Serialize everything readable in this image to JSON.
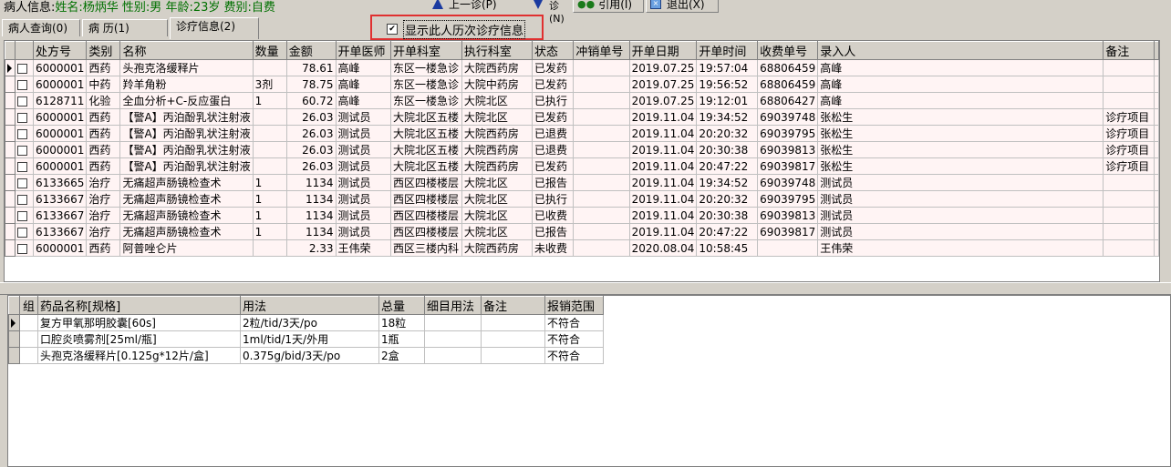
{
  "patient": {
    "label": "病人信息:",
    "name": "姓名:杨炳华",
    "gender": "性别:男",
    "age": "年龄:23岁",
    "fee_type": "费别:自费"
  },
  "toolbar": {
    "prev_label": "上一诊(P)",
    "next_label": "下一诊(N)",
    "cite_label": "引用(I)",
    "exit_label": "退出(X)"
  },
  "tabs": [
    {
      "label": "病人查询(0)"
    },
    {
      "label": "病 历(1)"
    },
    {
      "label": "诊疗信息(2)"
    }
  ],
  "show_history": {
    "label": "显示此人历次诊疗信息",
    "checked": "✔"
  },
  "orders": {
    "columns": [
      "处方号",
      "类别",
      "名称",
      "数量",
      "金额",
      "开单医师",
      "开单科室",
      "执行科室",
      "状态",
      "冲销单号",
      "开单日期",
      "开单时间",
      "收费单号",
      "录入人",
      "备注"
    ],
    "rows": [
      {
        "rx": "6000001",
        "cat": "西药",
        "name": "头孢克洛缓释片",
        "qty": "",
        "amt": "78.61",
        "doc": "高峰",
        "dept": "东区一楼急诊",
        "exec": "大院西药房",
        "status": "已发药",
        "cancel": "",
        "date": "2019.07.25",
        "time": "19:57:04",
        "fee": "68806459",
        "entry": "高峰",
        "note": ""
      },
      {
        "rx": "6000001",
        "cat": "中药",
        "name": "羚羊角粉",
        "qty": "3剂",
        "amt": "78.75",
        "doc": "高峰",
        "dept": "东区一楼急诊",
        "exec": "大院中药房",
        "status": "已发药",
        "cancel": "",
        "date": "2019.07.25",
        "time": "19:56:52",
        "fee": "68806459",
        "entry": "高峰",
        "note": ""
      },
      {
        "rx": "6128711",
        "cat": "化验",
        "name": "全血分析+C-反应蛋白",
        "qty": "1",
        "amt": "60.72",
        "doc": "高峰",
        "dept": "东区一楼急诊",
        "exec": "大院北区",
        "status": "已执行",
        "cancel": "",
        "date": "2019.07.25",
        "time": "19:12:01",
        "fee": "68806427",
        "entry": "高峰",
        "note": ""
      },
      {
        "rx": "6000001",
        "cat": "西药",
        "name": "【警A】丙泊酚乳状注射液",
        "qty": "",
        "amt": "26.03",
        "doc": "测试员",
        "dept": "大院北区五楼",
        "exec": "大院北区",
        "status": "已发药",
        "cancel": "",
        "date": "2019.11.04",
        "time": "19:34:52",
        "fee": "69039748",
        "entry": "张松生",
        "note": "诊疗项目"
      },
      {
        "rx": "6000001",
        "cat": "西药",
        "name": "【警A】丙泊酚乳状注射液",
        "qty": "",
        "amt": "26.03",
        "doc": "测试员",
        "dept": "大院北区五楼",
        "exec": "大院西药房",
        "status": "已退费",
        "cancel": "",
        "date": "2019.11.04",
        "time": "20:20:32",
        "fee": "69039795",
        "entry": "张松生",
        "note": "诊疗项目"
      },
      {
        "rx": "6000001",
        "cat": "西药",
        "name": "【警A】丙泊酚乳状注射液",
        "qty": "",
        "amt": "26.03",
        "doc": "测试员",
        "dept": "大院北区五楼",
        "exec": "大院西药房",
        "status": "已退费",
        "cancel": "",
        "date": "2019.11.04",
        "time": "20:30:38",
        "fee": "69039813",
        "entry": "张松生",
        "note": "诊疗项目"
      },
      {
        "rx": "6000001",
        "cat": "西药",
        "name": "【警A】丙泊酚乳状注射液",
        "qty": "",
        "amt": "26.03",
        "doc": "测试员",
        "dept": "大院北区五楼",
        "exec": "大院西药房",
        "status": "已发药",
        "cancel": "",
        "date": "2019.11.04",
        "time": "20:47:22",
        "fee": "69039817",
        "entry": "张松生",
        "note": "诊疗项目"
      },
      {
        "rx": "6133665",
        "cat": "治疗",
        "name": "无痛超声肠镜检查术",
        "qty": "1",
        "amt": "1134",
        "doc": "测试员",
        "dept": "西区四楼楼层",
        "exec": "大院北区",
        "status": "已报告",
        "cancel": "",
        "date": "2019.11.04",
        "time": "19:34:52",
        "fee": "69039748",
        "entry": "测试员",
        "note": ""
      },
      {
        "rx": "6133667",
        "cat": "治疗",
        "name": "无痛超声肠镜检查术",
        "qty": "1",
        "amt": "1134",
        "doc": "测试员",
        "dept": "西区四楼楼层",
        "exec": "大院北区",
        "status": "已执行",
        "cancel": "",
        "date": "2019.11.04",
        "time": "20:20:32",
        "fee": "69039795",
        "entry": "测试员",
        "note": ""
      },
      {
        "rx": "6133667",
        "cat": "治疗",
        "name": "无痛超声肠镜检查术",
        "qty": "1",
        "amt": "1134",
        "doc": "测试员",
        "dept": "西区四楼楼层",
        "exec": "大院北区",
        "status": "已收费",
        "cancel": "",
        "date": "2019.11.04",
        "time": "20:30:38",
        "fee": "69039813",
        "entry": "测试员",
        "note": ""
      },
      {
        "rx": "6133667",
        "cat": "治疗",
        "name": "无痛超声肠镜检查术",
        "qty": "1",
        "amt": "1134",
        "doc": "测试员",
        "dept": "西区四楼楼层",
        "exec": "大院北区",
        "status": "已报告",
        "cancel": "",
        "date": "2019.11.04",
        "time": "20:47:22",
        "fee": "69039817",
        "entry": "测试员",
        "note": ""
      },
      {
        "rx": "6000001",
        "cat": "西药",
        "name": "阿普唑仑片",
        "qty": "",
        "amt": "2.33",
        "doc": "王伟荣",
        "dept": "西区三楼内科",
        "exec": "大院西药房",
        "status": "未收费",
        "cancel": "",
        "date": "2020.08.04",
        "time": "10:58:45",
        "fee": "",
        "entry": "王伟荣",
        "note": ""
      }
    ]
  },
  "drugs": {
    "columns": [
      "组",
      "药品名称[规格]",
      "用法",
      "总量",
      "细目用法",
      "备注",
      "报销范围"
    ],
    "rows": [
      {
        "group": "",
        "name": "复方甲氧那明胶囊[60s]",
        "usage": "2粒/tid/3天/po",
        "total": "18粒",
        "detail": "",
        "note": "",
        "scope": "不符合"
      },
      {
        "group": "",
        "name": "口腔炎喷雾剂[25ml/瓶]",
        "usage": "1ml/tid/1天/外用",
        "total": "1瓶",
        "detail": "",
        "note": "",
        "scope": "不符合"
      },
      {
        "group": "",
        "name": "头孢克洛缓释片[0.125g*12片/盒]",
        "usage": "0.375g/bid/3天/po",
        "total": "2盒",
        "detail": "",
        "note": "",
        "scope": "不符合"
      }
    ]
  }
}
